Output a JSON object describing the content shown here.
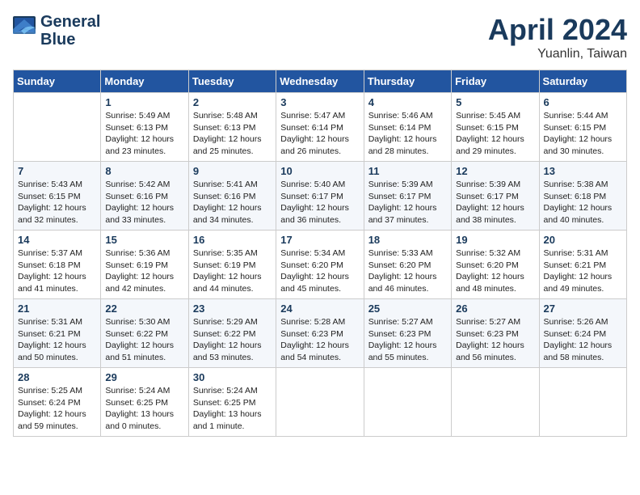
{
  "header": {
    "logo_line1": "General",
    "logo_line2": "Blue",
    "month": "April 2024",
    "location": "Yuanlin, Taiwan"
  },
  "days_of_week": [
    "Sunday",
    "Monday",
    "Tuesday",
    "Wednesday",
    "Thursday",
    "Friday",
    "Saturday"
  ],
  "weeks": [
    [
      {
        "day": "",
        "info": ""
      },
      {
        "day": "1",
        "info": "Sunrise: 5:49 AM\nSunset: 6:13 PM\nDaylight: 12 hours\nand 23 minutes."
      },
      {
        "day": "2",
        "info": "Sunrise: 5:48 AM\nSunset: 6:13 PM\nDaylight: 12 hours\nand 25 minutes."
      },
      {
        "day": "3",
        "info": "Sunrise: 5:47 AM\nSunset: 6:14 PM\nDaylight: 12 hours\nand 26 minutes."
      },
      {
        "day": "4",
        "info": "Sunrise: 5:46 AM\nSunset: 6:14 PM\nDaylight: 12 hours\nand 28 minutes."
      },
      {
        "day": "5",
        "info": "Sunrise: 5:45 AM\nSunset: 6:15 PM\nDaylight: 12 hours\nand 29 minutes."
      },
      {
        "day": "6",
        "info": "Sunrise: 5:44 AM\nSunset: 6:15 PM\nDaylight: 12 hours\nand 30 minutes."
      }
    ],
    [
      {
        "day": "7",
        "info": "Sunrise: 5:43 AM\nSunset: 6:15 PM\nDaylight: 12 hours\nand 32 minutes."
      },
      {
        "day": "8",
        "info": "Sunrise: 5:42 AM\nSunset: 6:16 PM\nDaylight: 12 hours\nand 33 minutes."
      },
      {
        "day": "9",
        "info": "Sunrise: 5:41 AM\nSunset: 6:16 PM\nDaylight: 12 hours\nand 34 minutes."
      },
      {
        "day": "10",
        "info": "Sunrise: 5:40 AM\nSunset: 6:17 PM\nDaylight: 12 hours\nand 36 minutes."
      },
      {
        "day": "11",
        "info": "Sunrise: 5:39 AM\nSunset: 6:17 PM\nDaylight: 12 hours\nand 37 minutes."
      },
      {
        "day": "12",
        "info": "Sunrise: 5:39 AM\nSunset: 6:17 PM\nDaylight: 12 hours\nand 38 minutes."
      },
      {
        "day": "13",
        "info": "Sunrise: 5:38 AM\nSunset: 6:18 PM\nDaylight: 12 hours\nand 40 minutes."
      }
    ],
    [
      {
        "day": "14",
        "info": "Sunrise: 5:37 AM\nSunset: 6:18 PM\nDaylight: 12 hours\nand 41 minutes."
      },
      {
        "day": "15",
        "info": "Sunrise: 5:36 AM\nSunset: 6:19 PM\nDaylight: 12 hours\nand 42 minutes."
      },
      {
        "day": "16",
        "info": "Sunrise: 5:35 AM\nSunset: 6:19 PM\nDaylight: 12 hours\nand 44 minutes."
      },
      {
        "day": "17",
        "info": "Sunrise: 5:34 AM\nSunset: 6:20 PM\nDaylight: 12 hours\nand 45 minutes."
      },
      {
        "day": "18",
        "info": "Sunrise: 5:33 AM\nSunset: 6:20 PM\nDaylight: 12 hours\nand 46 minutes."
      },
      {
        "day": "19",
        "info": "Sunrise: 5:32 AM\nSunset: 6:20 PM\nDaylight: 12 hours\nand 48 minutes."
      },
      {
        "day": "20",
        "info": "Sunrise: 5:31 AM\nSunset: 6:21 PM\nDaylight: 12 hours\nand 49 minutes."
      }
    ],
    [
      {
        "day": "21",
        "info": "Sunrise: 5:31 AM\nSunset: 6:21 PM\nDaylight: 12 hours\nand 50 minutes."
      },
      {
        "day": "22",
        "info": "Sunrise: 5:30 AM\nSunset: 6:22 PM\nDaylight: 12 hours\nand 51 minutes."
      },
      {
        "day": "23",
        "info": "Sunrise: 5:29 AM\nSunset: 6:22 PM\nDaylight: 12 hours\nand 53 minutes."
      },
      {
        "day": "24",
        "info": "Sunrise: 5:28 AM\nSunset: 6:23 PM\nDaylight: 12 hours\nand 54 minutes."
      },
      {
        "day": "25",
        "info": "Sunrise: 5:27 AM\nSunset: 6:23 PM\nDaylight: 12 hours\nand 55 minutes."
      },
      {
        "day": "26",
        "info": "Sunrise: 5:27 AM\nSunset: 6:23 PM\nDaylight: 12 hours\nand 56 minutes."
      },
      {
        "day": "27",
        "info": "Sunrise: 5:26 AM\nSunset: 6:24 PM\nDaylight: 12 hours\nand 58 minutes."
      }
    ],
    [
      {
        "day": "28",
        "info": "Sunrise: 5:25 AM\nSunset: 6:24 PM\nDaylight: 12 hours\nand 59 minutes."
      },
      {
        "day": "29",
        "info": "Sunrise: 5:24 AM\nSunset: 6:25 PM\nDaylight: 13 hours\nand 0 minutes."
      },
      {
        "day": "30",
        "info": "Sunrise: 5:24 AM\nSunset: 6:25 PM\nDaylight: 13 hours\nand 1 minute."
      },
      {
        "day": "",
        "info": ""
      },
      {
        "day": "",
        "info": ""
      },
      {
        "day": "",
        "info": ""
      },
      {
        "day": "",
        "info": ""
      }
    ]
  ]
}
